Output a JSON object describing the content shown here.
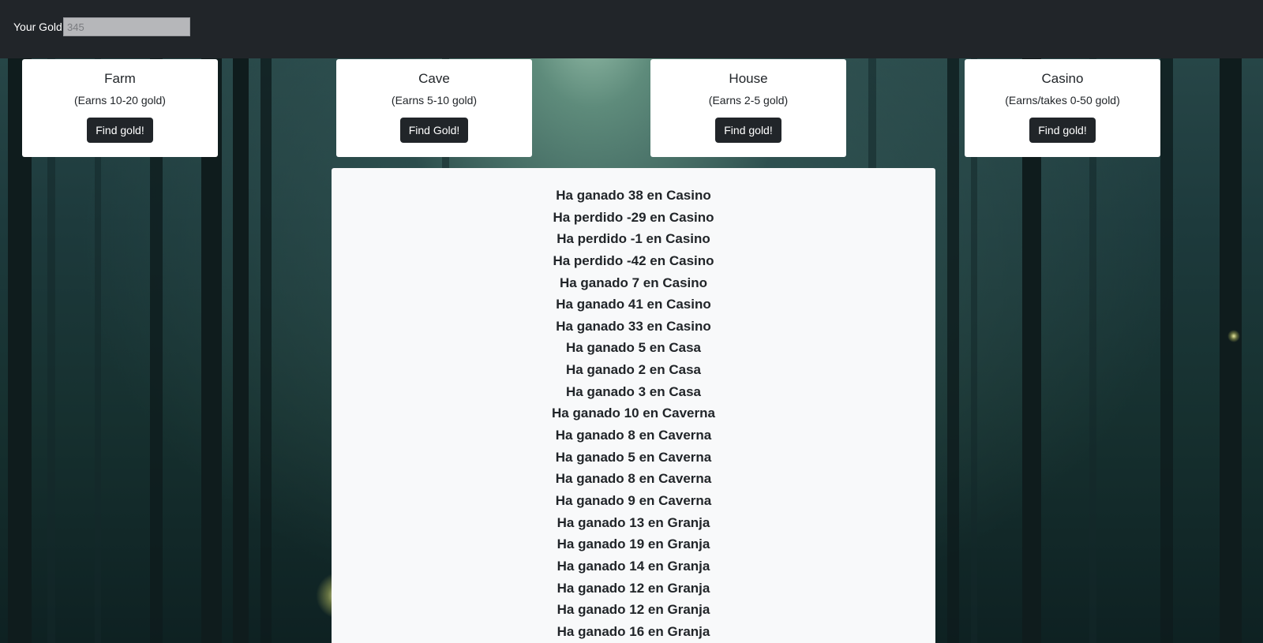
{
  "header": {
    "gold_label": "Your Gold:",
    "gold_value": "345"
  },
  "places": [
    {
      "name": "Farm",
      "earnings": "(Earns 10-20 gold)",
      "button": "Find gold!"
    },
    {
      "name": "Cave",
      "earnings": "(Earns 5-10 gold)",
      "button": "Find Gold!"
    },
    {
      "name": "House",
      "earnings": "(Earns 2-5 gold)",
      "button": "Find gold!"
    },
    {
      "name": "Casino",
      "earnings": "(Earns/takes 0-50 gold)",
      "button": "Find gold!"
    }
  ],
  "log": [
    "Ha ganado 38 en Casino",
    "Ha perdido -29 en Casino",
    "Ha perdido -1 en Casino",
    "Ha perdido -42 en Casino",
    "Ha ganado 7 en Casino",
    "Ha ganado 41 en Casino",
    "Ha ganado 33 en Casino",
    "Ha ganado 5 en Casa",
    "Ha ganado 2 en Casa",
    "Ha ganado 3 en Casa",
    "Ha ganado 10 en Caverna",
    "Ha ganado 8 en Caverna",
    "Ha ganado 5 en Caverna",
    "Ha ganado 8 en Caverna",
    "Ha ganado 9 en Caverna",
    "Ha ganado 13 en Granja",
    "Ha ganado 19 en Granja",
    "Ha ganado 14 en Granja",
    "Ha ganado 12 en Granja",
    "Ha ganado 12 en Granja",
    "Ha ganado 16 en Granja"
  ],
  "colors": {
    "navbar": "#212529",
    "card": "#ffffff",
    "log_panel": "#f8f9fa",
    "button": "#212529"
  }
}
